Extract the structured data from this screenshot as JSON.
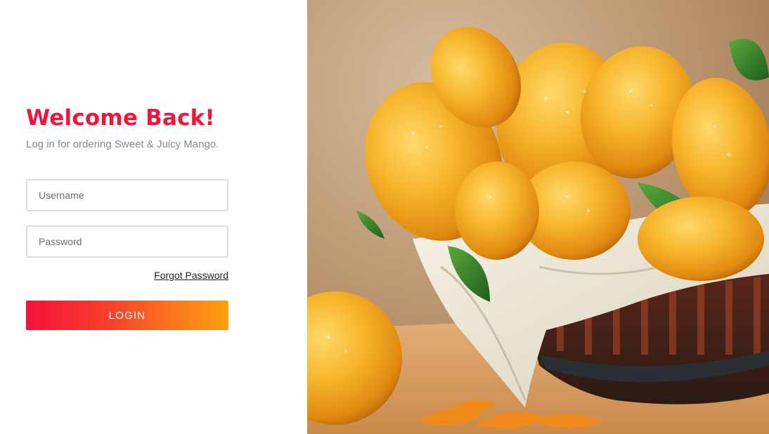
{
  "login": {
    "title": "Welcome Back!",
    "subtitle": "Log in for ordering Sweet & Juicy Mango.",
    "username_placeholder": "Username",
    "password_placeholder": "Password",
    "forgot_password_label": "Forgot Password",
    "login_button_label": "LOGIN"
  },
  "colors": {
    "title": "#f0163a",
    "button_gradient_start": "#f5113a",
    "button_gradient_end": "#fda010",
    "subtitle": "#8a8a8a"
  },
  "hero": {
    "image": "mango-basket-photo"
  }
}
